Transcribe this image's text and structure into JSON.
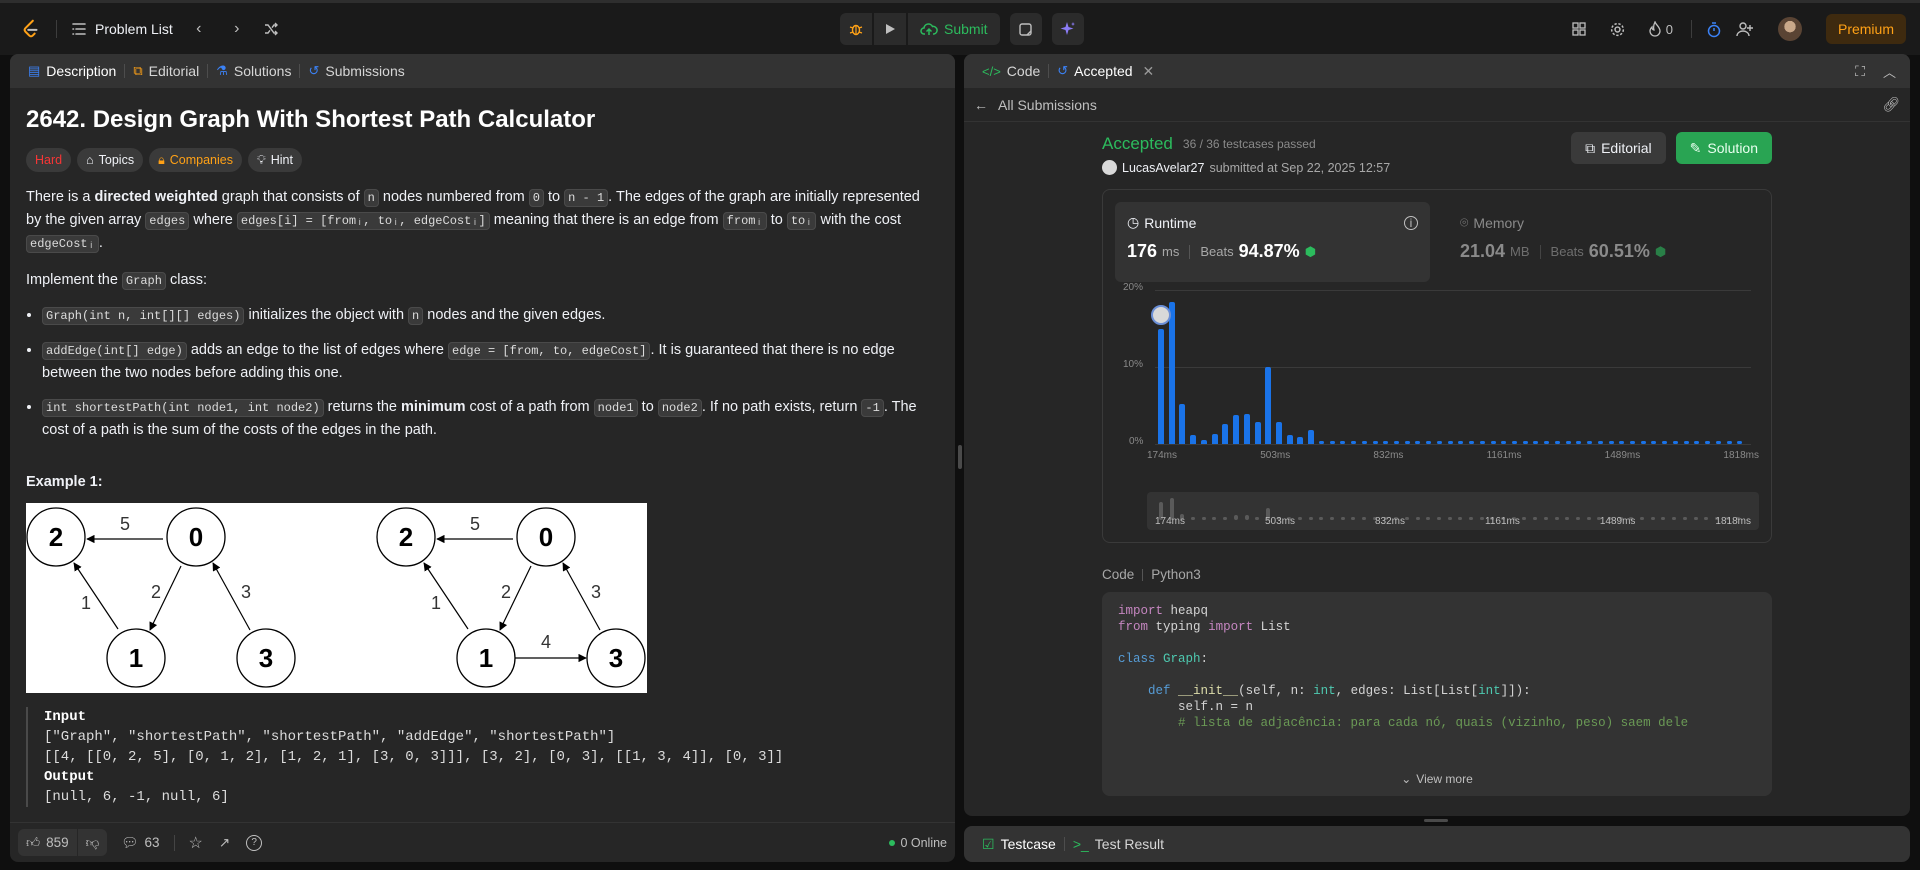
{
  "topbar": {
    "title": "Problem List",
    "submit_label": "Submit",
    "streak_count": "0",
    "premium_label": "Premium"
  },
  "left": {
    "tabs": [
      "Description",
      "Editorial",
      "Solutions",
      "Submissions"
    ],
    "problem_title": "2642. Design Graph With Shortest Path Calculator",
    "difficulty": "Hard",
    "tags": [
      "Topics",
      "Companies",
      "Hint"
    ],
    "intro": {
      "t1": "There is a ",
      "bold": "directed weighted",
      "t2": " graph that consists of ",
      "c_n": "n",
      "t3": " nodes numbered from ",
      "c_0": "0",
      "t4": " to ",
      "c_n1": "n - 1",
      "t5": ". The edges of the graph are initially represented by the given array ",
      "c_edges": "edges",
      "t6": " where ",
      "c_edgesi": "edges[i] = [fromᵢ, toᵢ, edgeCostᵢ]",
      "t7": " meaning that there is an edge from ",
      "c_from": "fromᵢ",
      "t8": " to ",
      "c_to": "toᵢ",
      "t9": " with the cost ",
      "c_cost": "edgeCostᵢ",
      "t10": "."
    },
    "impl": {
      "t1": "Implement the ",
      "c": "Graph",
      "t2": " class:"
    },
    "bullets": {
      "b1": {
        "c1": "Graph(int n, int[][] edges)",
        "t1": " initializes the object with ",
        "c2": "n",
        "t2": " nodes and the given edges."
      },
      "b2": {
        "c1": "addEdge(int[] edge)",
        "t1": " adds an edge to the list of edges where ",
        "c2": "edge = [from, to, edgeCost]",
        "t2": ". It is guaranteed that there is no edge between the two nodes before adding this one."
      },
      "b3": {
        "c1": "int shortestPath(int node1, int node2)",
        "t1": " returns the ",
        "bold": "minimum",
        "t2": " cost of a path from ",
        "c2": "node1",
        "t3": " to ",
        "c3": "node2",
        "t4": ". If no path exists, return ",
        "c4": "-1",
        "t5": ". The cost of a path is the sum of the costs of the edges in the path."
      }
    },
    "example_title": "Example 1:",
    "graph": {
      "nodes": [
        "2",
        "0",
        "1",
        "3"
      ],
      "weights_left": [
        "5",
        "1",
        "2",
        "3"
      ],
      "weights_right": [
        "5",
        "1",
        "2",
        "3",
        "4"
      ]
    },
    "example": {
      "input_label": "Input",
      "input_line1": "[\"Graph\", \"shortestPath\", \"shortestPath\", \"addEdge\", \"shortestPath\"]",
      "input_line2": "[[4, [[0, 2, 5], [0, 1, 2], [1, 2, 1], [3, 0, 3]]], [3, 2], [0, 3], [[1, 3, 4]], [0, 3]]",
      "output_label": "Output",
      "output_line": "[null, 6, -1, null, 6]"
    },
    "footer": {
      "likes": "859",
      "comments": "63",
      "online": "0 Online"
    }
  },
  "right": {
    "tabs": [
      "Code",
      "Accepted"
    ],
    "back_label": "All Submissions",
    "status": "Accepted",
    "testcases": "36 / 36 testcases passed",
    "user": "LucasAvelar27",
    "submitted": "submitted at Sep 22, 2025 12:57",
    "editorial_btn": "Editorial",
    "solution_btn": "Solution",
    "runtime": {
      "label": "Runtime",
      "value": "176",
      "unit": "ms",
      "beats_label": "Beats",
      "beats": "94.87%"
    },
    "memory": {
      "label": "Memory",
      "value": "21.04",
      "unit": "MB",
      "beats_label": "Beats",
      "beats": "60.51%"
    },
    "code_label": "Code",
    "lang": "Python3",
    "view_more": "View more",
    "code_lines": [
      "import heapq",
      "from typing import List",
      "",
      "class Graph:",
      "",
      "    def __init__(self, n: int, edges: List[List[int]]):",
      "        self.n = n",
      "        # lista de adjacência: para cada nó, quais (vizinho, peso) saem dele"
    ],
    "bottom_tabs": [
      "Testcase",
      "Test Result"
    ]
  },
  "chart_data": {
    "type": "bar",
    "title": "",
    "xlabel": "",
    "ylabel": "",
    "y_ticks": [
      "20%",
      "10%",
      "0%"
    ],
    "ylim": [
      0,
      20
    ],
    "x_ticks": [
      "174ms",
      "503ms",
      "832ms",
      "1161ms",
      "1489ms",
      "1818ms"
    ],
    "series": [
      {
        "values": [
          15,
          18.5,
          5.2,
          1.2,
          0.5,
          1.3,
          2.6,
          3.8,
          3.9,
          2.9,
          10,
          2.9,
          1.2,
          0.9,
          1.8,
          0.3,
          0.3,
          0.3,
          0.3,
          0.3,
          0.3,
          0.3,
          0.3,
          0.3,
          0.3,
          0.3,
          0.3,
          0.3,
          0.3,
          0.3,
          0.3,
          0.3,
          0.3,
          0.3,
          0.3,
          0.3,
          0.3,
          0.3,
          0.3,
          0.3,
          0.3,
          0.3,
          0.3,
          0.3,
          0.3,
          0.3,
          0.3,
          0.3,
          0.3,
          0.3,
          0.3,
          0.3,
          0.3,
          0.3,
          0.3
        ]
      }
    ],
    "highlight_index": 0,
    "grid": true,
    "bar_color": "#1a73e8"
  }
}
